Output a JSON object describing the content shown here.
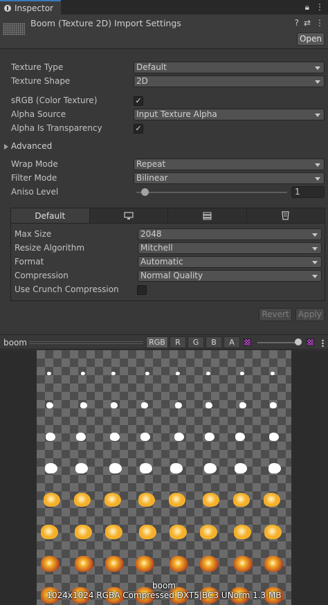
{
  "tab": {
    "title": "Inspector"
  },
  "header": {
    "title": "Boom (Texture 2D) Import Settings",
    "open_label": "Open"
  },
  "props": {
    "texture_type": {
      "label": "Texture Type",
      "value": "Default"
    },
    "texture_shape": {
      "label": "Texture Shape",
      "value": "2D"
    },
    "srgb": {
      "label": "sRGB (Color Texture)",
      "checked": true
    },
    "alpha_source": {
      "label": "Alpha Source",
      "value": "Input Texture Alpha"
    },
    "alpha_transparency": {
      "label": "Alpha Is Transparency",
      "checked": true
    },
    "advanced": {
      "label": "Advanced"
    },
    "wrap_mode": {
      "label": "Wrap Mode",
      "value": "Repeat"
    },
    "filter_mode": {
      "label": "Filter Mode",
      "value": "Bilinear"
    },
    "aniso": {
      "label": "Aniso Level",
      "value": "1"
    }
  },
  "platform": {
    "tabs": [
      {
        "label": "Default",
        "icon": ""
      },
      {
        "label": "",
        "icon": "monitor-icon"
      },
      {
        "label": "",
        "icon": "server-icon"
      },
      {
        "label": "",
        "icon": "webgl-icon"
      }
    ],
    "max_size": {
      "label": "Max Size",
      "value": "2048"
    },
    "resize": {
      "label": "Resize Algorithm",
      "value": "Mitchell"
    },
    "format": {
      "label": "Format",
      "value": "Automatic"
    },
    "compression": {
      "label": "Compression",
      "value": "Normal Quality"
    },
    "crunch": {
      "label": "Use Crunch Compression",
      "checked": false
    }
  },
  "buttons": {
    "revert": "Revert",
    "apply": "Apply"
  },
  "preview": {
    "name": "boom",
    "channels": [
      "RGB",
      "R",
      "G",
      "B",
      "A"
    ],
    "caption_name": "boom",
    "caption_info": "1024x1024  RGBA Compressed DXT5|BC3 UNorm   1.3 MB"
  },
  "colors": {
    "accent": "#3a79bb",
    "flame_core": "#fff4c8",
    "flame_mid": "#f5b02a",
    "flame_outer": "#b3401a"
  }
}
